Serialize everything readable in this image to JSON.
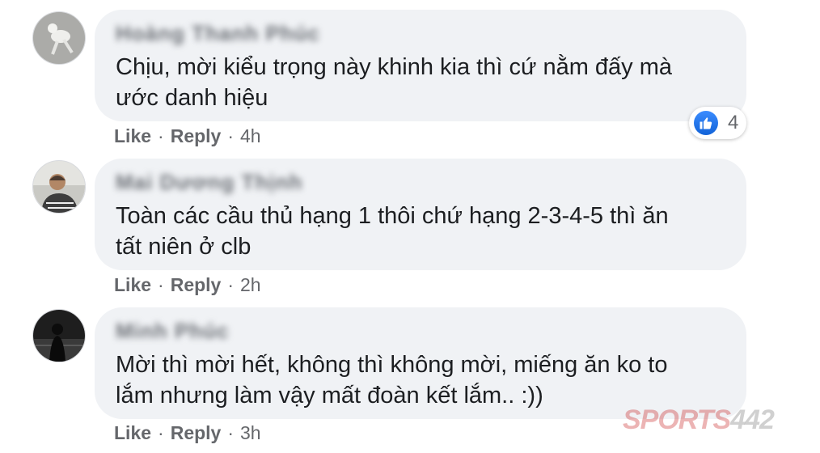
{
  "comments": [
    {
      "author": "Hoàng Thanh Phúc",
      "text_lines": [
        "Chịu, mời kiểu trọng này khinh kia thì cứ nằm đấy mà",
        "ước danh hiệu"
      ],
      "like": "Like",
      "reply": "Reply",
      "time": "4h",
      "reaction_count": "4"
    },
    {
      "author": "Mai Dương Thịnh",
      "text_lines": [
        "Toàn các cầu thủ hạng 1 thôi chứ hạng 2-3-4-5 thì ăn",
        "tất niên ở clb"
      ],
      "like": "Like",
      "reply": "Reply",
      "time": "2h"
    },
    {
      "author": "Minh Phúc",
      "text_lines": [
        "Mời thì mời hết, không thì không mời, miếng ăn ko to",
        "lắm nhưng làm vậy mất đoàn kết lắm.. :))"
      ],
      "like": "Like",
      "reply": "Reply",
      "time": "3h"
    }
  ],
  "separator": "·",
  "watermark": {
    "brand": "SPORTS",
    "number": "442"
  },
  "colors": {
    "like_blue": "#1877f2",
    "bubble_bg": "#f0f2f5",
    "meta_gray": "#65676b"
  }
}
